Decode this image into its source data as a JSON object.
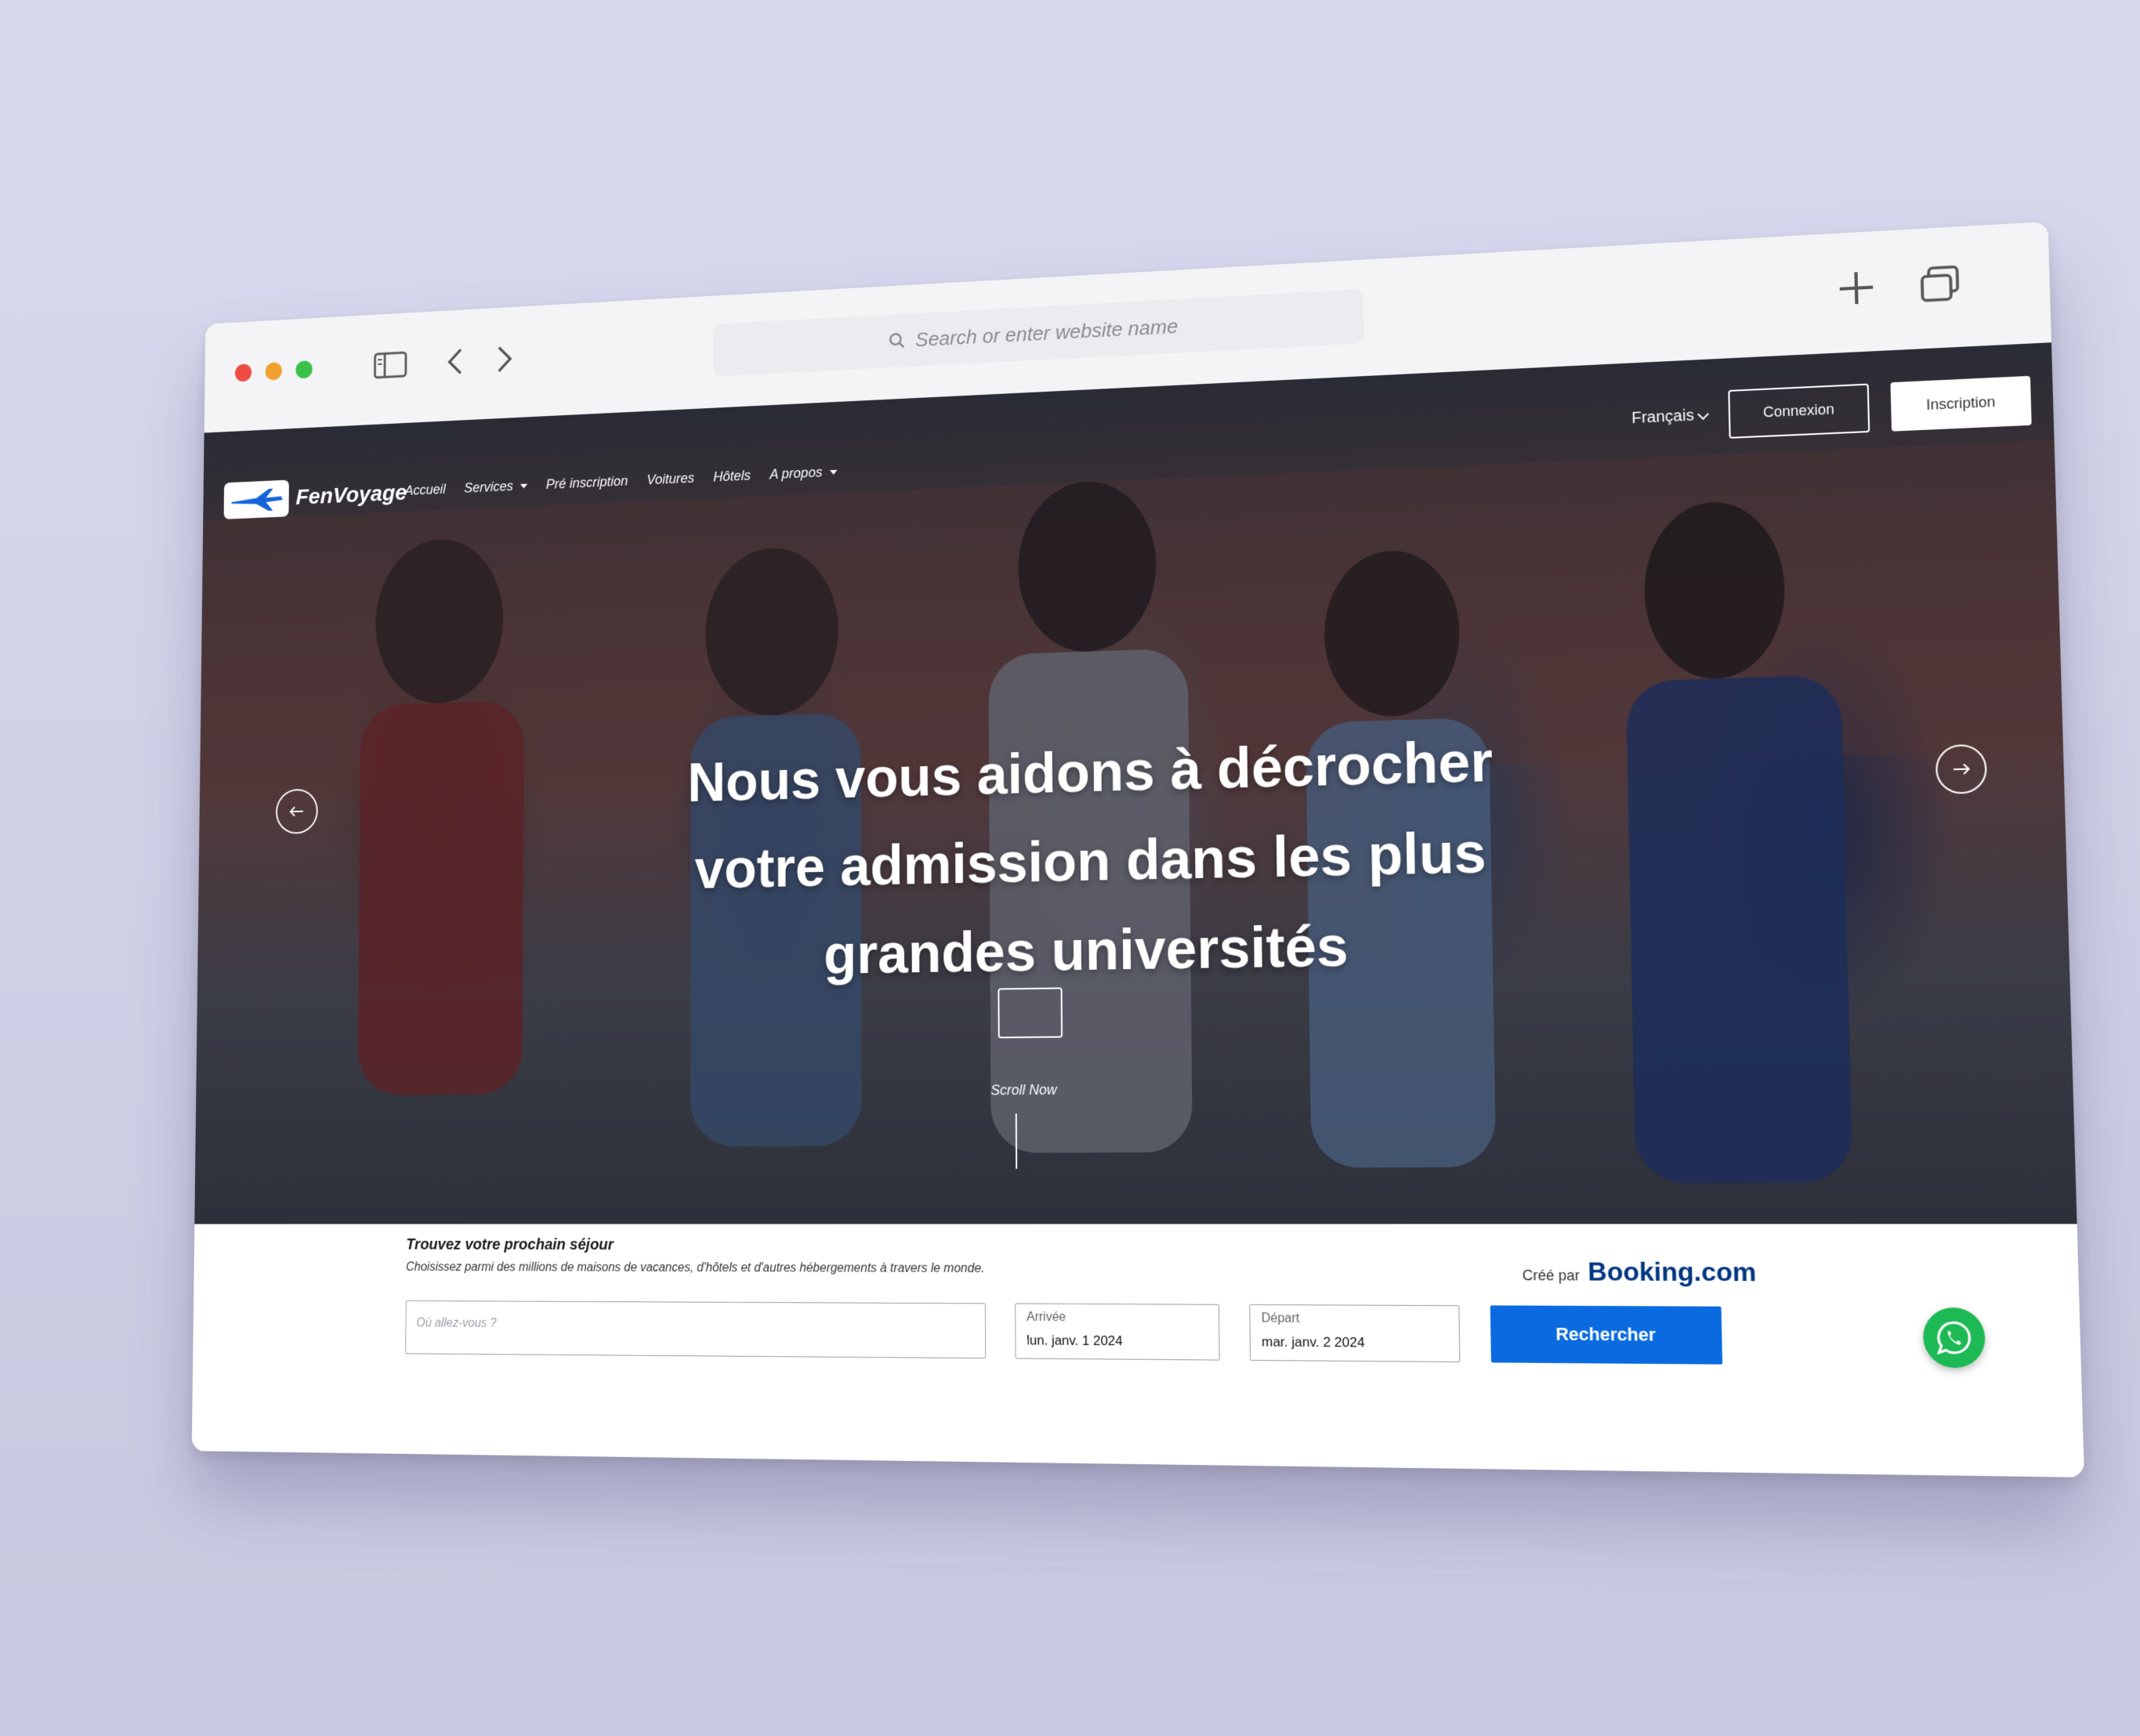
{
  "browser": {
    "address_placeholder": "Search or enter website name"
  },
  "site": {
    "brand": "FenVoyage",
    "nav": [
      "Accueil",
      "Services",
      "Pré inscription",
      "Voitures",
      "Hôtels",
      "A propos"
    ],
    "language": "Français",
    "login": "Connexion",
    "signup": "Inscription"
  },
  "hero": {
    "title_lines": [
      "Nous vous aidons à décrocher",
      "votre admission dans les plus",
      "grandes universités"
    ],
    "scroll_label": "Scroll Now"
  },
  "booking": {
    "title": "Trouvez votre prochain séjour",
    "subtitle": "Choisissez parmi des millions de maisons de vacances, d'hôtels et d'autres hébergements à travers le monde.",
    "destination_placeholder": "Où allez-vous ?",
    "arrival_label": "Arrivée",
    "arrival_value": "lun. janv. 1 2024",
    "departure_label": "Départ",
    "departure_value": "mar. janv. 2 2024",
    "search_button": "Rechercher",
    "powered_by": "Créé par",
    "powered_brand": "Booking.com"
  },
  "icons": {
    "sidebar": "sidebar-icon",
    "back": "chevron-left-icon",
    "forward": "chevron-right-icon",
    "search": "search-icon",
    "new_tab": "plus-icon",
    "tabs": "tabs-icon",
    "whatsapp": "whatsapp-icon"
  },
  "colors": {
    "primary_blue": "#0a6adf",
    "booking_blue": "#003580",
    "whatsapp_green": "#1db954"
  }
}
